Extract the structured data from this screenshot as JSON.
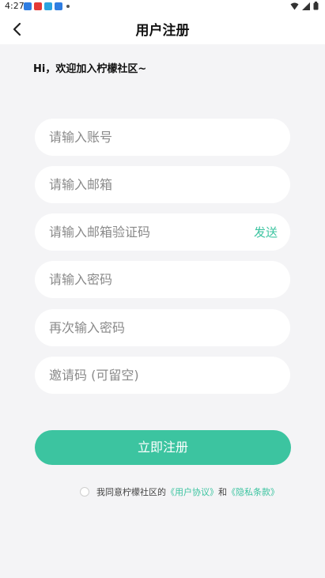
{
  "status_bar": {
    "time": "4:27"
  },
  "header": {
    "title": "用户注册"
  },
  "welcome": "Hi，欢迎加入柠檬社区~",
  "form": {
    "account_placeholder": "请输入账号",
    "email_placeholder": "请输入邮箱",
    "code_placeholder": "请输入邮箱验证码",
    "send_label": "发送",
    "password_placeholder": "请输入密码",
    "confirm_placeholder": "再次输入密码",
    "invite_placeholder": "邀请码 (可留空)"
  },
  "register_label": "立即注册",
  "agreement": {
    "prefix": "我同意柠檬社区的",
    "user_agreement": "《用户协议》",
    "and": "和",
    "privacy_policy": "《隐私条款》"
  },
  "colors": {
    "accent": "#3cc4a0",
    "background": "#f4f4f6",
    "field": "#ffffff"
  }
}
